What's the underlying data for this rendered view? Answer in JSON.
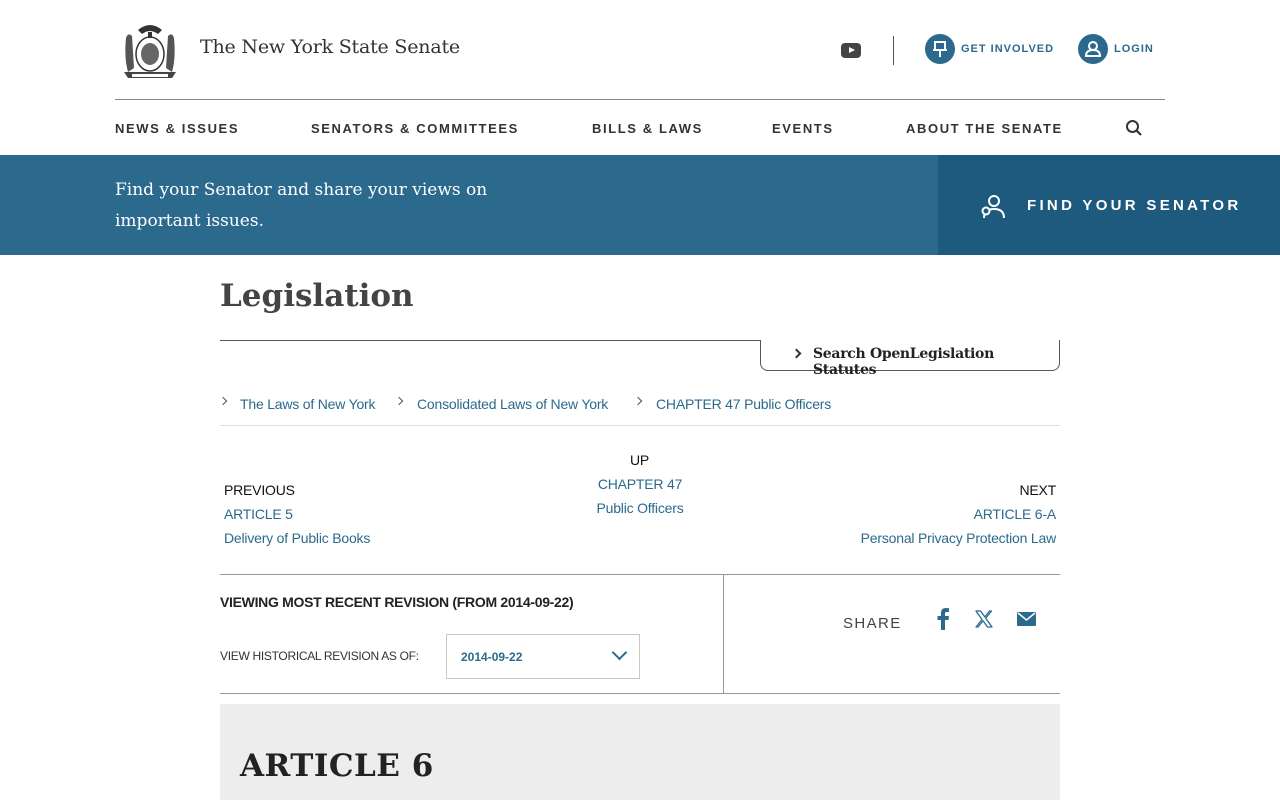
{
  "header": {
    "site_title": "The New York State Senate",
    "get_involved": "GET INVOLVED",
    "login": "LOGIN"
  },
  "nav": {
    "items": [
      "NEWS & ISSUES",
      "SENATORS & COMMITTEES",
      "BILLS & LAWS",
      "EVENTS",
      "ABOUT THE SENATE"
    ]
  },
  "banner": {
    "line1": "Find your Senator and share your views on",
    "line2": "important issues.",
    "cta": "FIND YOUR SENATOR"
  },
  "page": {
    "title": "Legislation",
    "search_statutes": "Search OpenLegislation Statutes"
  },
  "breadcrumb": {
    "item1": "The Laws of New York",
    "item2": "Consolidated Laws of New York",
    "item3_code": "CHAPTER 47",
    "item3_name": "Public Officers"
  },
  "pager": {
    "up_label": "UP",
    "up_code": "CHAPTER 47",
    "up_name": "Public Officers",
    "prev_label": "PREVIOUS",
    "prev_code": "ARTICLE 5",
    "prev_name": "Delivery of Public Books",
    "next_label": "NEXT",
    "next_code": "ARTICLE 6-A",
    "next_name": "Personal Privacy Protection Law"
  },
  "revision": {
    "title": "VIEWING MOST RECENT REVISION (FROM 2014-09-22)",
    "historical_label": "VIEW HISTORICAL REVISION AS OF:",
    "selected_date": "2014-09-22"
  },
  "share": {
    "label": "SHARE"
  },
  "article": {
    "title": "ARTICLE 6"
  },
  "colors": {
    "brand_blue": "#2b6a8d",
    "banner_dark": "#1e5a7e"
  }
}
